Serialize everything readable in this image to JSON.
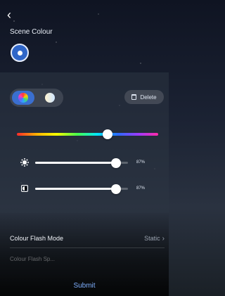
{
  "header": {
    "back_icon": "chevron-left-icon",
    "title": "Scene Colour"
  },
  "scene": {
    "selected_color": "#2f66c8"
  },
  "mode_toggle": {
    "modes": [
      "color-wheel-icon",
      "temperature-icon"
    ],
    "active_index": 0
  },
  "delete": {
    "label": "Delete",
    "icon": "trash-icon"
  },
  "hue": {
    "position": 0.64
  },
  "brightness": {
    "icon": "sun-icon",
    "percent_label": "87%",
    "value": 0.87
  },
  "saturation": {
    "icon": "contrast-icon",
    "percent_label": "87%",
    "value": 0.87
  },
  "flash_mode": {
    "label": "Colour Flash Mode",
    "value": "Static"
  },
  "flash_speed": {
    "label": "Colour Flash Sp..."
  },
  "submit": {
    "label": "Submit"
  },
  "colors": {
    "accent": "#3a6fd0",
    "submit_text": "#7fb0ff"
  }
}
